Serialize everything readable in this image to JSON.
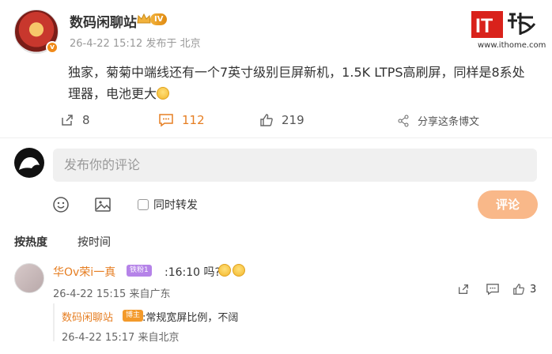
{
  "post": {
    "author": "数码闲聊站",
    "level": "IV",
    "avatar_badge": "v",
    "meta": "26-4-22 15:12  发布于 北京",
    "text": "独家，菊菊中端线还有一个7英寸级别巨屏新机，1.5K LTPS高刷屏，同样是8系处理器，电池更大"
  },
  "watermark": {
    "logo_text": "IT之家",
    "url": "www.ithome.com"
  },
  "actions": {
    "repost_count": "8",
    "comment_count": "112",
    "like_count": "219",
    "share_label": "分享这条博文"
  },
  "composer": {
    "placeholder": "发布你的评论",
    "repost_label": "同时转发",
    "submit_label": "评论",
    "tool_icons": [
      "emoji-icon",
      "image-icon"
    ]
  },
  "sort_tabs": [
    {
      "label": "按热度",
      "active": true
    },
    {
      "label": "按时间",
      "active": false
    }
  ],
  "comments": [
    {
      "name": "华Ov荣i一真",
      "badge": "铁粉1",
      "text": ":16:10 吗?",
      "meta": "26-4-22 15:15  来自广东",
      "likes": "3",
      "reply": {
        "name": "数码闲聊站",
        "badge": "博主",
        "text": ":常规宽屏比例，不阔",
        "meta": "26-4-22 15:17  来自北京"
      }
    }
  ],
  "colors": {
    "accent": "#e67e22",
    "submit": "#f9b889",
    "input_bg": "#f0f0f0"
  }
}
